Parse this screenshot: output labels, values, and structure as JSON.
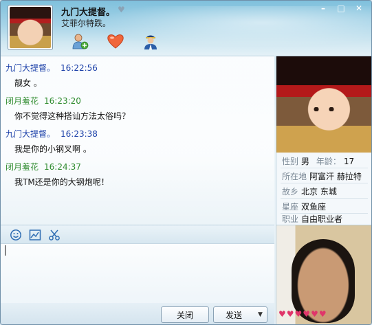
{
  "header": {
    "name": "九门大提督。",
    "name_heart": "♥",
    "signature": "艾菲尔特跌。",
    "icons": [
      "add-friend-icon",
      "heart-icon",
      "police-avatar-icon"
    ],
    "window_controls": {
      "minimize": "–",
      "maximize": "□",
      "close": "✕"
    }
  },
  "messages": [
    {
      "sender": "九门大提督。",
      "time": "16:22:56",
      "text": "靓女 。",
      "side": "peer"
    },
    {
      "sender": "闭月羞花",
      "time": "16:23:20",
      "text": "你不觉得这种搭讪方法太俗吗？",
      "side": "me"
    },
    {
      "sender": "九门大提督。",
      "time": "16:23:38",
      "text": "我是你的小钢叉啊 。",
      "side": "peer"
    },
    {
      "sender": "闭月羞花",
      "time": "16:24:37",
      "text": "我TM还是你的大钢炮呢！",
      "side": "me"
    }
  ],
  "profile": {
    "gender_label": "性别",
    "gender": "男",
    "age_label": "年龄：",
    "age": "17",
    "location_label": "所在地",
    "location": "阿富汗 赫拉特",
    "hometown_label": "故乡",
    "hometown": "北京 东城",
    "zodiac_label": "星座",
    "zodiac": "双鱼座",
    "job_label": "职业",
    "job": "自由职业者"
  },
  "toolbar": {
    "icons": [
      "emoji-icon",
      "screenshot-icon",
      "scissors-icon"
    ]
  },
  "buttons": {
    "close_label": "关闭",
    "send_label": "发送",
    "send_arrow": "▼"
  },
  "hearts": [
    "♥",
    "♥",
    "♥",
    "♥",
    "♥",
    "♥"
  ],
  "colors": {
    "peer_name": "#1a3fa8",
    "me_name": "#2e8b2e",
    "hearts": "#e0356a"
  }
}
